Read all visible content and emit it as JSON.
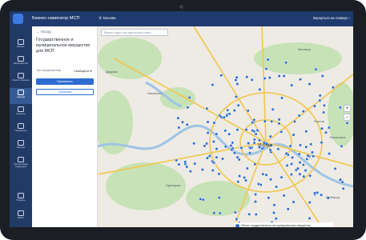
{
  "topbar": {
    "brand": "Бизнес-навигатор МСП",
    "location": "Москва",
    "back_link": "Вернуться на главную"
  },
  "sidebar": {
    "items": [
      {
        "label": "Бизнес",
        "icon": "briefcase-icon",
        "active": false
      },
      {
        "label": "Мероприятия",
        "icon": "calendar-icon",
        "active": false
      },
      {
        "label": "Расчёт бизнеса",
        "icon": "calculator-icon",
        "active": false
      },
      {
        "label": "Аренда",
        "icon": "building-icon",
        "active": true
      },
      {
        "label": "Кредиты",
        "icon": "credit-icon",
        "active": false
      },
      {
        "label": "Поддержка",
        "icon": "support-icon",
        "active": false
      },
      {
        "label": "Закупки",
        "icon": "cart-icon",
        "active": false
      },
      {
        "label": "Прочие меры поддержки",
        "icon": "info-icon",
        "active": false
      },
      {
        "label": "Помощь",
        "icon": "help-icon",
        "active": false
      },
      {
        "label": "Войти",
        "icon": "login-icon",
        "active": false
      }
    ]
  },
  "panel": {
    "back": "← Назад",
    "title": "Государственное и муниципальное имущество для МСП",
    "filter_label": "Тип предложения",
    "filter_value": "Свободное ▾",
    "apply_label": "Применить",
    "reset_label": "Сбросить"
  },
  "map": {
    "search_placeholder": "Введите адрес или кадастровый номер",
    "labels": [
      "Дедовск",
      "Нахабино",
      "Мытищи",
      "Москва",
      "Одинцово",
      "Балашиха",
      "Реутов",
      "Люберцы"
    ],
    "legend": "Объект государственного или муниципального имущества",
    "zoom_in": "+",
    "zoom_out": "−",
    "colors": {
      "marker": "#2e6cd1",
      "green": "#c7e2b6",
      "water": "#9ec4e6",
      "road": "#f2c64a",
      "land": "#eeebe4"
    }
  }
}
